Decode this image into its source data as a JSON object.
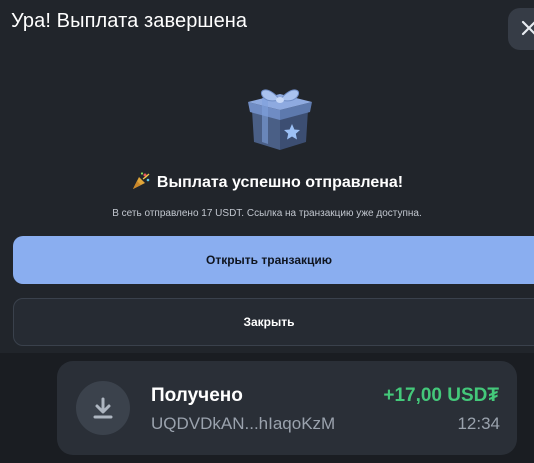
{
  "modal": {
    "title": "Ура! Выплата завершена",
    "success_text": "Выплата успешно отправлена!",
    "description": "В сеть отправлено 17 USDT. Ссылка на транзакцию уже доступна.",
    "primary_button": "Открыть транзакцию",
    "secondary_button": "Закрыть",
    "icons": [
      "close-icon",
      "gift-icon",
      "party-popper-icon"
    ]
  },
  "transaction": {
    "title": "Получено",
    "address": "UQDVDkAN...hIaqoKzM",
    "amount": "+17,00 USD₮",
    "time": "12:34",
    "icon": "download-arrow-icon"
  },
  "colors": {
    "primary_button": "#8aaef0",
    "amount_positive": "#44c87a",
    "modal_background": "#21252b",
    "page_background": "#1a1d22"
  }
}
